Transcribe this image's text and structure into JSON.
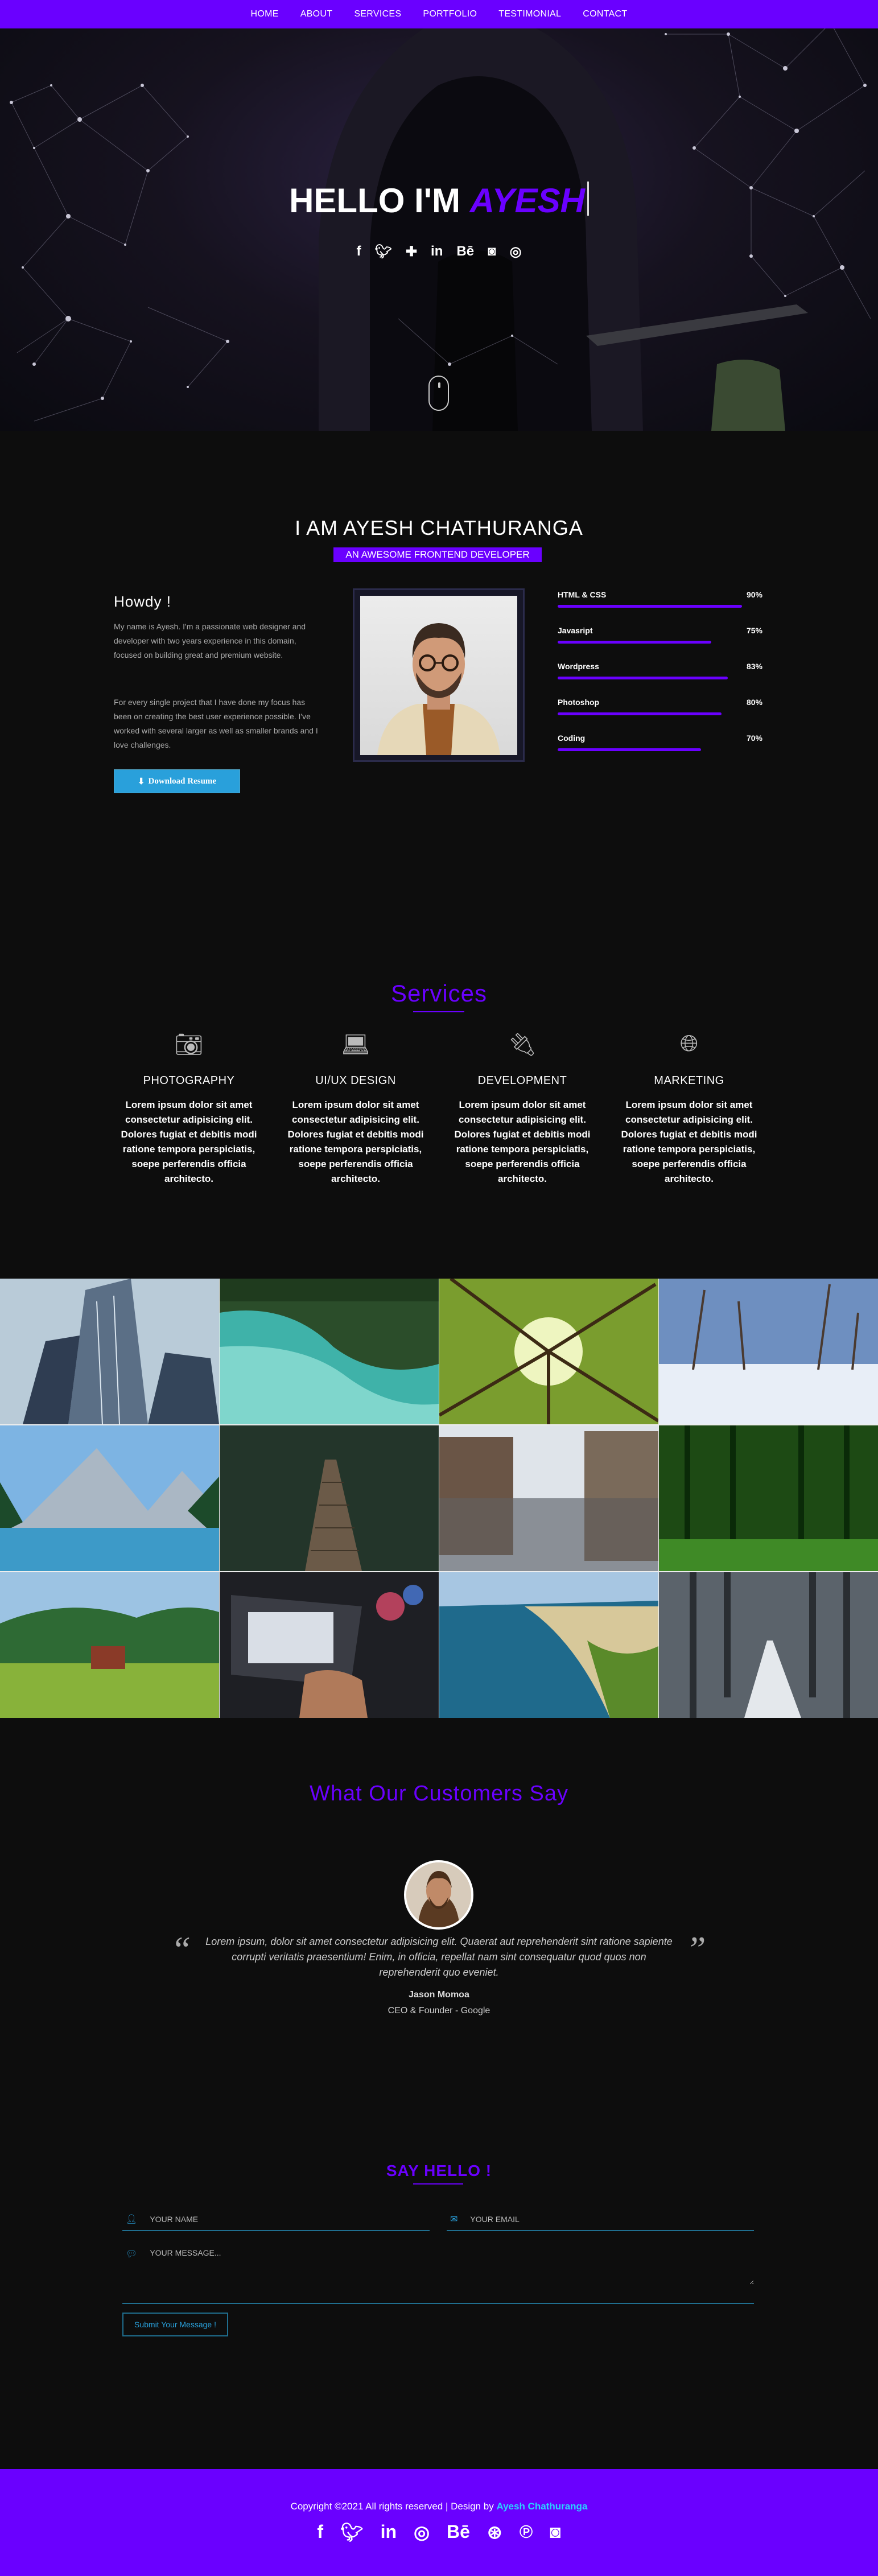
{
  "nav": {
    "items": [
      "HOME",
      "ABOUT",
      "SERVICES",
      "PORTFOLIO",
      "TESTIMONIAL",
      "CONTACT"
    ]
  },
  "hero": {
    "greeting": "HELLO I'M",
    "name": "AYESH",
    "social_icons": [
      "facebook-icon",
      "twitter-icon",
      "google-plus-icon",
      "linkedin-icon",
      "behance-icon",
      "flickr-icon",
      "instagram-icon"
    ]
  },
  "about": {
    "heading": "I AM AYESH CHATHURANGA",
    "subtitle": "AN AWESOME FRONTEND DEVELOPER",
    "howdy": "Howdy !",
    "para1": "My name is Ayesh. I'm a passionate web designer and developer with two years experience in this domain, focused on building great and premium website.",
    "para2": "For every single project that I have done my focus has been on creating the best user experience possible. I've worked with several larger as well as smaller brands and I love challenges.",
    "download_label": "Download Resume",
    "skills": [
      {
        "name": "HTML & CSS",
        "percent_label": "90%",
        "level": 0.9
      },
      {
        "name": "Javasript",
        "percent_label": "75%",
        "level": 0.75
      },
      {
        "name": "Wordpress",
        "percent_label": "83%",
        "level": 0.83
      },
      {
        "name": "Photoshop",
        "percent_label": "80%",
        "level": 0.8
      },
      {
        "name": "Coding",
        "percent_label": "70%",
        "level": 0.7
      }
    ]
  },
  "services": {
    "title": "Services",
    "items": [
      {
        "icon": "camera-icon",
        "title": "PHOTOGRAPHY",
        "text": "Lorem ipsum dolor sit amet consectetur adipisicing elit. Dolores fugiat et debitis modi ratione tempora perspiciatis, soepe perferendis officia architecto."
      },
      {
        "icon": "laptop-icon",
        "title": "UI/UX DESIGN",
        "text": "Lorem ipsum dolor sit amet consectetur adipisicing elit. Dolores fugiat et debitis modi ratione tempora perspiciatis, soepe perferendis officia architecto."
      },
      {
        "icon": "plug-icon",
        "title": "DEVELOPMENT",
        "text": "Lorem ipsum dolor sit amet consectetur adipisicing elit. Dolores fugiat et debitis modi ratione tempora perspiciatis, soepe perferendis officia architecto."
      },
      {
        "icon": "globe-icon",
        "title": "MARKETING",
        "text": "Lorem ipsum dolor sit amet consectetur adipisicing elit. Dolores fugiat et debitis modi ratione tempora perspiciatis, soepe perferendis officia architecto."
      }
    ]
  },
  "testimonial": {
    "title": "What Our Customers Say",
    "quote": "Lorem ipsum, dolor sit amet consectetur adipisicing elit. Quaerat aut reprehenderit sint ratione sapiente corrupti veritatis praesentium! Enim, in officia, repellat nam sint consequatur quod quos non reprehenderit quo eveniet.",
    "name": "Jason Momoa",
    "role": "CEO & Founder - Google"
  },
  "contact": {
    "title": "SAY HELLO !",
    "name_placeholder": "YOUR NAME",
    "email_placeholder": "YOUR EMAIL",
    "message_placeholder": "YOUR MESSAGE...",
    "submit_label": "Submit Your Message !"
  },
  "footer": {
    "copyright": "Copyright ©2021 All rights reserved | Design by",
    "brand": "Ayesh Chathuranga",
    "social_icons": [
      "facebook-icon",
      "twitter-icon",
      "linkedin-icon",
      "instagram-icon",
      "behance-icon",
      "dribbble-icon",
      "pinterest-icon",
      "flickr-icon"
    ]
  },
  "colors": {
    "accent": "#6a00ff",
    "link_blue": "#29a0db",
    "background": "#0d0d0d"
  }
}
